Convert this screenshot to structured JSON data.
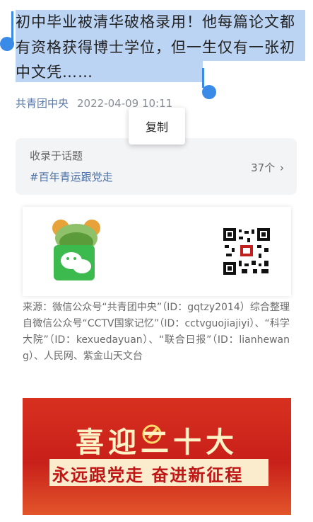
{
  "article": {
    "headline": "初中毕业被清华破格录用！他每篇论文都有资格获得博士学位，但一生仅有一张初中文凭……",
    "author": "共青团中央",
    "datetime": "2022-04-09 10:11"
  },
  "popup": {
    "copy_label": "复制"
  },
  "topic": {
    "label": "收录于话题",
    "tag": "#百年青运跟党走",
    "count": "37个"
  },
  "source": "来源：微信公众号“共青团中央”（ID：gqtzy2014）综合整理自微信公众号“CCTV国家记忆”（ID：cctvguojiajiyi）、“科学大院”（ID：kexuedayuan）、“联合日报”（ID：lianhewang）、人民网、紫金山天文台",
  "red_banner": {
    "title": "喜迎二十大",
    "slogan": "永远跟党走 奋进新征程"
  },
  "colors": {
    "selection": "#bcd4f3",
    "handle": "#3a8be8",
    "link": "#4a6fa5",
    "banner_red": "#c8201a"
  }
}
